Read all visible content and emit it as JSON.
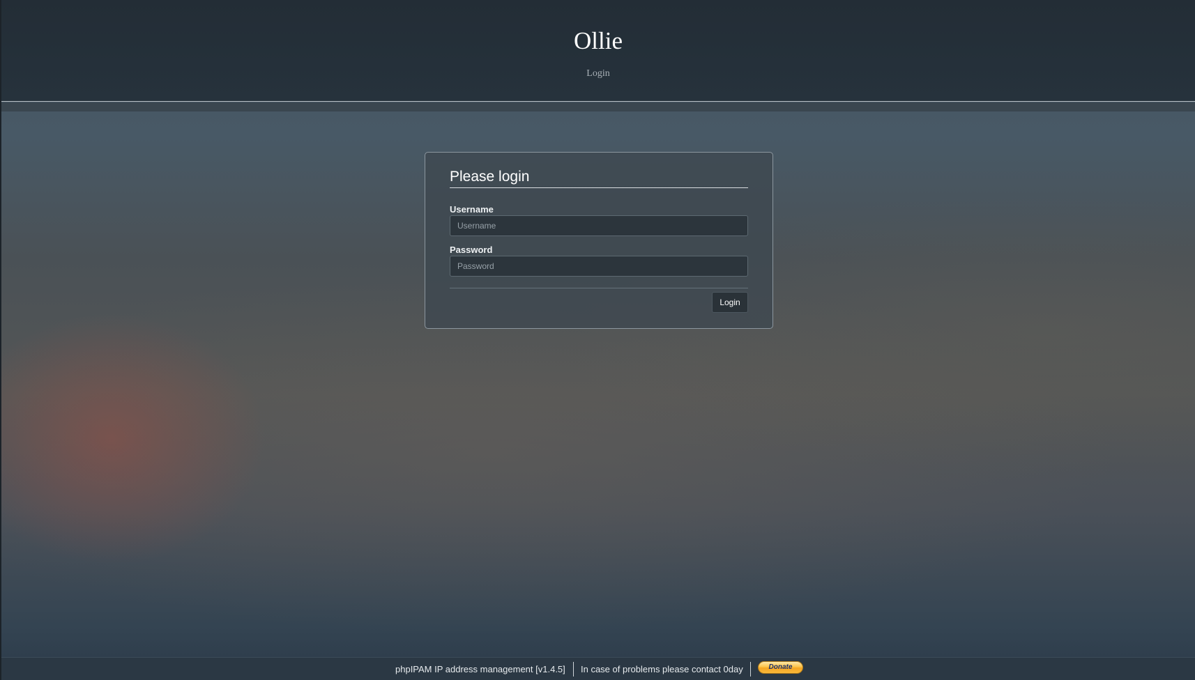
{
  "header": {
    "site_title": "Ollie",
    "subtitle": "Login"
  },
  "login_form": {
    "title": "Please login",
    "username_label": "Username",
    "username_placeholder": "Username",
    "password_label": "Password",
    "password_placeholder": "Password",
    "submit_label": "Login"
  },
  "footer": {
    "app_info": "phpIPAM IP address management [v1.4.5]",
    "contact_info": "In case of problems please contact 0day",
    "donate_label": "Donate"
  },
  "colors": {
    "header_bg": "#232d36",
    "footer_bg": "#2b3844",
    "donate_accent": "#fcc44a"
  }
}
